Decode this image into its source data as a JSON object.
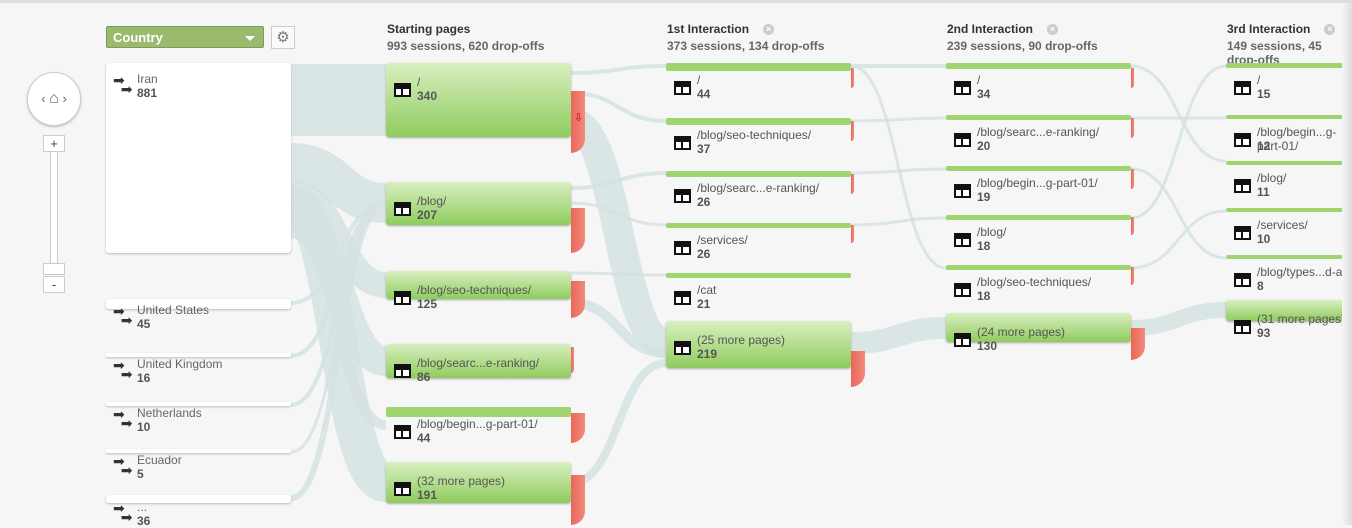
{
  "toolbar": {
    "dimension": "Country",
    "settings_icon": "gear-icon"
  },
  "nav": {
    "left": "‹",
    "home": "⌂",
    "right": "›",
    "zoom_in": "+",
    "zoom_out": "-"
  },
  "countries": [
    {
      "name": "Iran",
      "sessions": "881"
    },
    {
      "name": "United States",
      "sessions": "45"
    },
    {
      "name": "United Kingdom",
      "sessions": "16"
    },
    {
      "name": "Netherlands",
      "sessions": "10"
    },
    {
      "name": "Ecuador",
      "sessions": "5"
    },
    {
      "name": "...",
      "sessions": "36"
    }
  ],
  "columns": [
    {
      "title": "Starting pages",
      "summary": "993 sessions, 620 drop-offs",
      "pages": [
        {
          "path": "/",
          "sessions": "340"
        },
        {
          "path": "/blog/",
          "sessions": "207"
        },
        {
          "path": "/blog/seo-techniques/",
          "sessions": "125"
        },
        {
          "path": "/blog/searc...e-ranking/",
          "sessions": "86"
        },
        {
          "path": "/blog/begin...g-part-01/",
          "sessions": "44"
        },
        {
          "path": "(32 more pages)",
          "sessions": "191"
        }
      ]
    },
    {
      "title": "1st Interaction",
      "summary": "373 sessions, 134 drop-offs",
      "pages": [
        {
          "path": "/",
          "sessions": "44"
        },
        {
          "path": "/blog/seo-techniques/",
          "sessions": "37"
        },
        {
          "path": "/blog/searc...e-ranking/",
          "sessions": "26"
        },
        {
          "path": "/services/",
          "sessions": "26"
        },
        {
          "path": "/cat",
          "sessions": "21"
        },
        {
          "path": "(25 more pages)",
          "sessions": "219"
        }
      ]
    },
    {
      "title": "2nd Interaction",
      "summary": "239 sessions, 90 drop-offs",
      "pages": [
        {
          "path": "/",
          "sessions": "34"
        },
        {
          "path": "/blog/searc...e-ranking/",
          "sessions": "20"
        },
        {
          "path": "/blog/begin...g-part-01/",
          "sessions": "19"
        },
        {
          "path": "/blog/",
          "sessions": "18"
        },
        {
          "path": "/blog/seo-techniques/",
          "sessions": "18"
        },
        {
          "path": "(24 more pages)",
          "sessions": "130"
        }
      ]
    },
    {
      "title": "3rd Interaction",
      "summary": "149 sessions, 45 drop-offs",
      "pages": [
        {
          "path": "/",
          "sessions": "15"
        },
        {
          "path": "/blog/begin...g-part-01/",
          "sessions": "12"
        },
        {
          "path": "/blog/",
          "sessions": "11"
        },
        {
          "path": "/services/",
          "sessions": "10"
        },
        {
          "path": "/blog/types...d-an",
          "sessions": "8"
        },
        {
          "path": "(31 more pages)",
          "sessions": "93"
        }
      ]
    }
  ],
  "colors": {
    "node_green": "#8fcc5e",
    "dropoff_red": "#e8675a",
    "flow": "#d5e2e2",
    "dimension": "#9cba6e"
  }
}
